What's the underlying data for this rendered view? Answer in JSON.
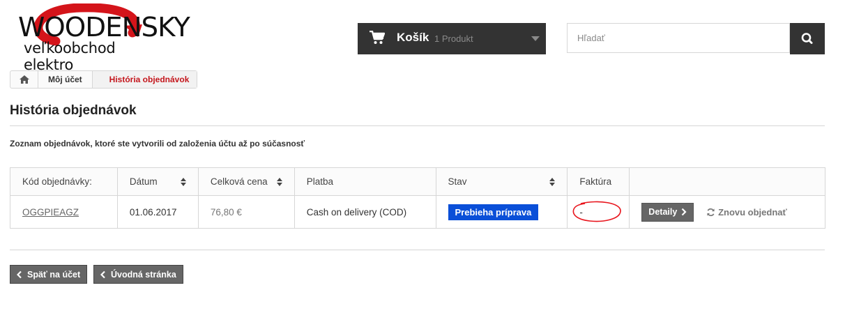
{
  "header": {
    "logo": {
      "line1": "WOODENSKY",
      "line2": "veľkoobchod elektro"
    },
    "cart": {
      "label": "Košík",
      "count": "1 Produkt"
    },
    "search": {
      "placeholder": "Hľadať"
    }
  },
  "breadcrumb": {
    "items": [
      "Môj účet",
      "História objednávok"
    ]
  },
  "page": {
    "title": "História objednávok",
    "intro": "Zoznam objednávok, ktoré ste vytvorili od založenia účtu až po súčasnosť"
  },
  "orders_table": {
    "headers": [
      "Kód objednávky:",
      "Dátum",
      "Celková cena",
      "Platba",
      "Stav",
      "Faktúra",
      ""
    ],
    "rows": [
      {
        "code": "OGGPIEAGZ",
        "date": "01.06.2017",
        "total": "76,80 €",
        "payment": "Cash on delivery (COD)",
        "status": "Prebieha príprava",
        "invoice": "-",
        "details_label": "Detaily",
        "reorder_label": "Znovu objednať"
      }
    ]
  },
  "footer_buttons": {
    "back_to_account": "Späť na účet",
    "home": "Úvodná stránka"
  },
  "colors": {
    "status_badge": "#0a4fd8",
    "breadcrumb_current": "#c4161c",
    "dark_bar": "#333333",
    "annotation_circle": "#e8141c"
  }
}
